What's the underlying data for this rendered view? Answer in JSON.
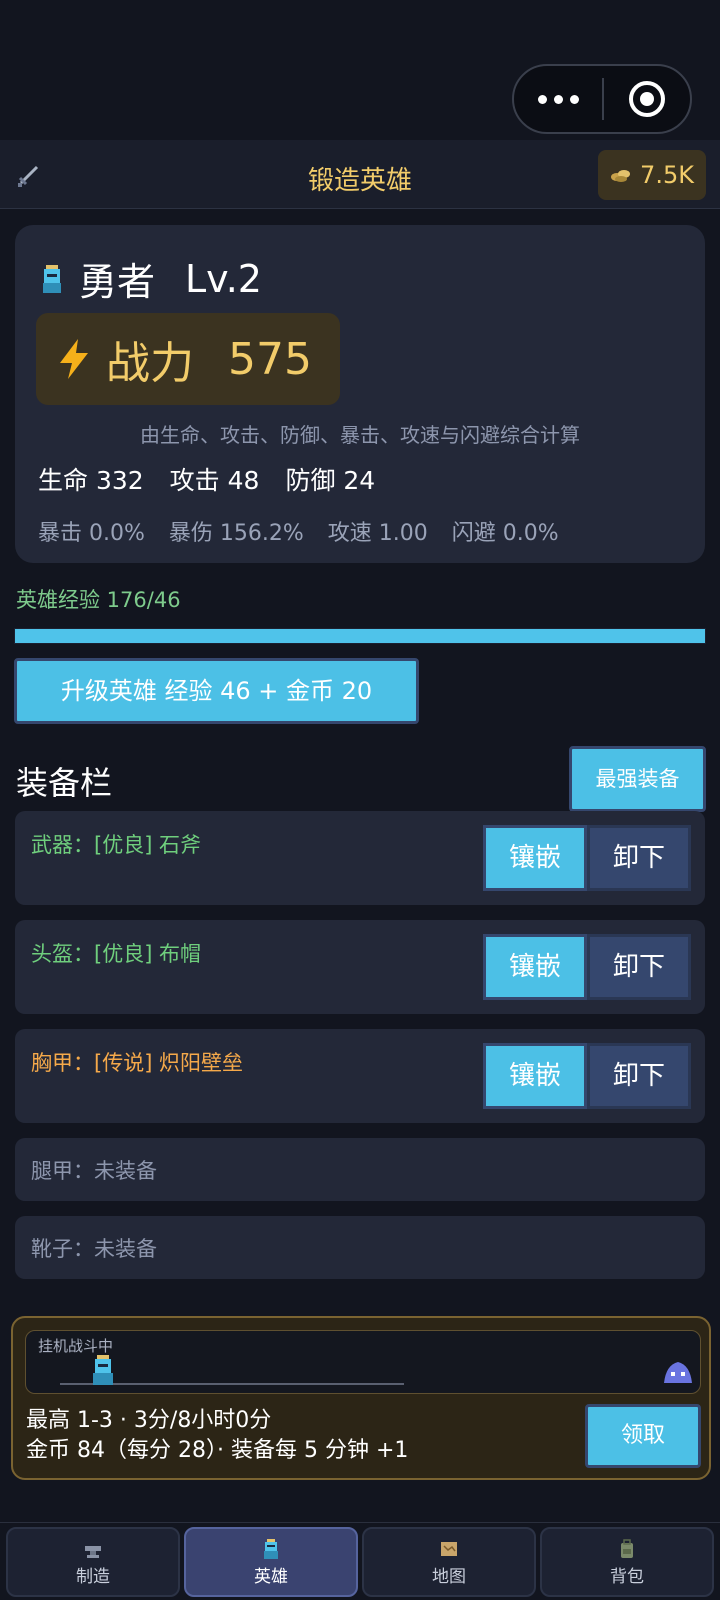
{
  "capsule": {
    "menu_icon": "more-dots-icon",
    "close_icon": "target-close-icon"
  },
  "header": {
    "title": "锻造英雄",
    "coins": "7.5K"
  },
  "hero": {
    "name": "勇者",
    "level": "Lv.2",
    "power_label": "战力",
    "power_value": "575",
    "power_note": "由生命、攻击、防御、暴击、攻速与闪避综合计算",
    "stats_main": [
      "生命 332",
      "攻击 48",
      "防御 24"
    ],
    "stats_sub": [
      "暴击 0.0%",
      "暴伤 156.2%",
      "攻速 1.00",
      "闪避 0.0%"
    ]
  },
  "experience": {
    "label": "英雄经验 176/46",
    "progress": 1.0
  },
  "upgrade_button": "升级英雄  经验 46 + 金币 20",
  "equipment": {
    "title": "装备栏",
    "best_button": "最强装备",
    "inlay_label": "镶嵌",
    "remove_label": "卸下",
    "slots": [
      {
        "text": "武器：[优良] 石斧",
        "quality": "green"
      },
      {
        "text": "头盔：[优良] 布帽",
        "quality": "green"
      },
      {
        "text": "胸甲：[传说] 炽阳壁垒",
        "quality": "gold"
      },
      {
        "text": "腿甲：未装备"
      },
      {
        "text": "靴子：未装备"
      }
    ]
  },
  "idle": {
    "status": "挂机战斗中",
    "line1": "最高 1-3 · 3分/8小时0分",
    "line2": "金币 84（每分 28）· 装备每 5 分钟 +1",
    "claim_button": "领取"
  },
  "nav": [
    {
      "label": "制造",
      "icon": "anvil-icon"
    },
    {
      "label": "英雄",
      "icon": "hero-icon",
      "active": true
    },
    {
      "label": "地图",
      "icon": "map-icon"
    },
    {
      "label": "背包",
      "icon": "backpack-icon"
    }
  ],
  "colors": {
    "accent": "#4cc0e6",
    "gold": "#f2cc6a",
    "good": "#6fcf7d",
    "legend": "#f5a94a"
  }
}
